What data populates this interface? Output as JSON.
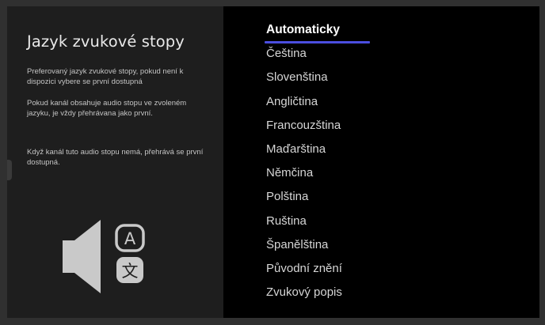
{
  "screen": {
    "title": "Jazyk zvukové stopy",
    "description_paragraphs": [
      "Preferovaný jazyk zvukové stopy, pokud není k dispozici vybere se první dostupná",
      "Pokud kanál obsahuje audio stopu ve zvoleném jazyku, je vždy přehrávana jako první.",
      "Když kanál tuto audio stopu nemá, přehrává se první dostupná."
    ],
    "illustration": {
      "icons": [
        "speaker-icon",
        "letter-a-icon",
        "chinese-character-icon"
      ],
      "letter": "A",
      "character": "文"
    }
  },
  "menu": {
    "selected_index": 0,
    "accent_color": "#4b4ee0",
    "items": [
      "Automaticky",
      "Čeština",
      "Slovenština",
      "Angličtina",
      "Francouzština",
      "Maďarština",
      "Němčina",
      "Polština",
      "Ruština",
      "Španělština",
      "Původní znění",
      "Zvukový popis"
    ]
  }
}
